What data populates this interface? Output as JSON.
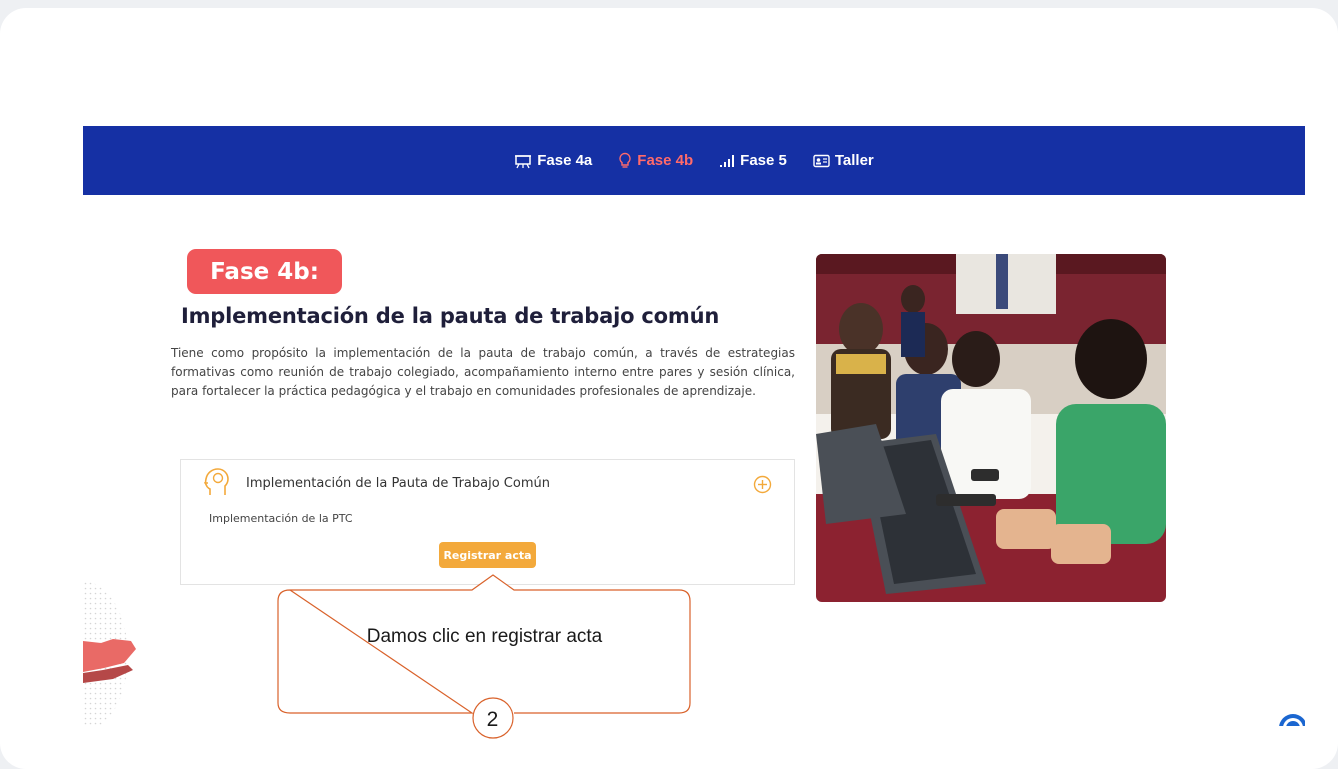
{
  "navbar": {
    "items": [
      {
        "label": "Fase 4a",
        "icon": "presentation-board-icon"
      },
      {
        "label": "Fase 4b",
        "icon": "lightbulb-icon",
        "active": true
      },
      {
        "label": "Fase 5",
        "icon": "signal-bars-icon"
      },
      {
        "label": "Taller",
        "icon": "id-card-icon"
      }
    ]
  },
  "badge": "Fase 4b:",
  "heading": "Implementación de la pauta de trabajo común",
  "description": "Tiene como propósito la implementación de la pauta de trabajo común, a través de estrategias formativas como reunión de trabajo colegiado, acompañamiento interno entre pares y sesión clínica, para fortalecer la práctica pedagógica y el trabajo en comunidades profesionales de aprendizaje.",
  "accordion": {
    "title": "Implementación de la Pauta de Trabajo Común",
    "subtitle": "Implementación de la PTC",
    "button": "Registrar acta",
    "icon": "head-brain-icon",
    "toggle_icon": "plus-circle-icon"
  },
  "callout": {
    "text": "Damos clic en registrar acta",
    "step": "2"
  },
  "colors": {
    "navbar": "#1530a4",
    "active_nav": "#ff6a6a",
    "badge": "#f0575a",
    "button": "#f3a93b",
    "callout_border": "#d9622b"
  }
}
